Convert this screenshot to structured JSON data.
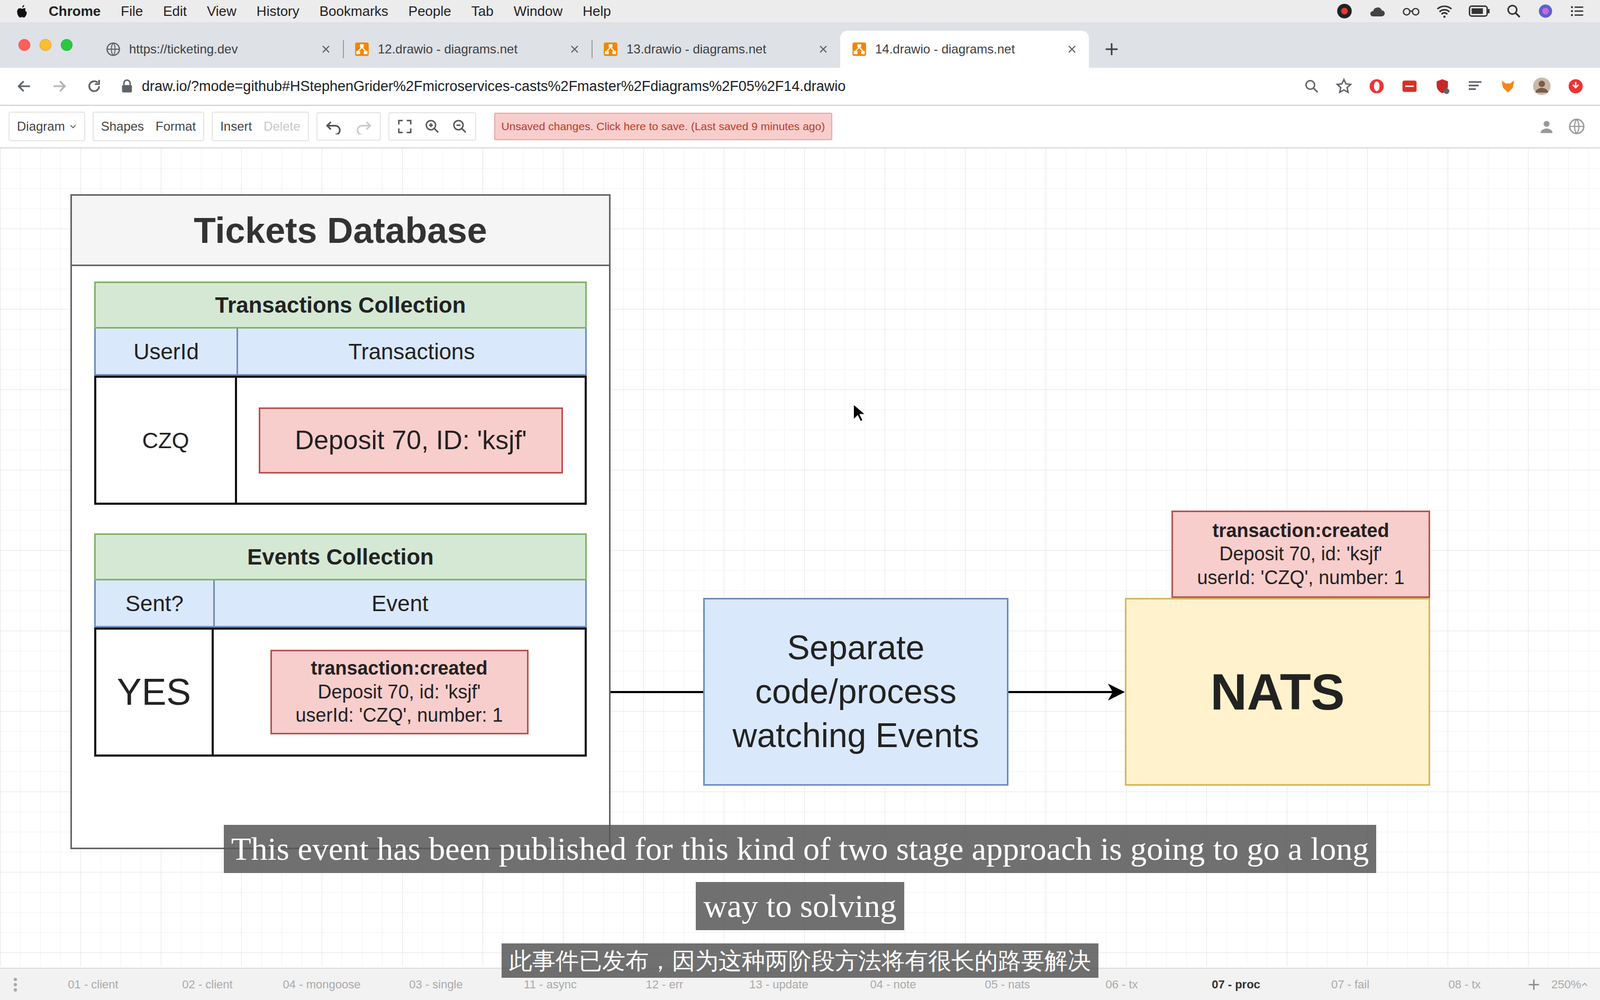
{
  "menubar": {
    "app": "Chrome",
    "items": [
      "File",
      "Edit",
      "View",
      "History",
      "Bookmarks",
      "People",
      "Tab",
      "Window",
      "Help"
    ]
  },
  "tabs": [
    {
      "label": "https://ticketing.dev",
      "kind": "web",
      "selected": false
    },
    {
      "label": "12.drawio - diagrams.net",
      "kind": "drawio",
      "selected": false
    },
    {
      "label": "13.drawio - diagrams.net",
      "kind": "drawio",
      "selected": false
    },
    {
      "label": "14.drawio - diagrams.net",
      "kind": "drawio",
      "selected": true
    }
  ],
  "address": "draw.io/?mode=github#HStephenGrider%2Fmicroservices-casts%2Fmaster%2Fdiagrams%2F05%2F14.drawio",
  "toolbar": {
    "groups": [
      [
        {
          "label": "Diagram",
          "disabled": false
        }
      ],
      [
        {
          "label": "Shapes",
          "disabled": false
        },
        {
          "label": "Format",
          "disabled": false
        }
      ],
      [
        {
          "label": "Insert",
          "disabled": false
        },
        {
          "label": "Delete",
          "disabled": true
        }
      ]
    ],
    "notice": "Unsaved changes. Click here to save. (Last saved 9 minutes ago)"
  },
  "history": {
    "undo_enabled": true,
    "redo_enabled": false
  },
  "diagram": {
    "database": {
      "title": "Tickets Database",
      "collections": [
        {
          "title": "Transactions Collection",
          "kind": "transactions",
          "columns": [
            "UserId",
            "Transactions"
          ],
          "rows": [
            {
              "key": "CZQ",
              "value": [
                "Deposit 70, ID: 'ksjf'"
              ]
            }
          ]
        },
        {
          "title": "Events Collection",
          "kind": "events",
          "columns": [
            "Sent?",
            "Event"
          ],
          "rows": [
            {
              "key": "YES",
              "value": [
                "transaction:created",
                "Deposit 70, id: 'ksjf'",
                "userId: 'CZQ', number: 1"
              ]
            }
          ]
        }
      ]
    },
    "process": [
      "Separate",
      "code/process",
      "watching Events"
    ],
    "nats": "NATS",
    "published": [
      "transaction:created",
      "Deposit 70, id: 'ksjf'",
      "userId: 'CZQ', number: 1"
    ]
  },
  "subtitles": {
    "english": [
      "This event has been published for this kind of two stage approach is going to go a long",
      "way to solving"
    ],
    "chinese": "此事件已发布，因为这种两阶段方法将有很长的路要解决"
  },
  "pages": [
    {
      "label": "01 - client",
      "selected": false
    },
    {
      "label": "02 - client",
      "selected": false
    },
    {
      "label": "04 - mongoose",
      "selected": false
    },
    {
      "label": "03 - single",
      "selected": false
    },
    {
      "label": "11 - async",
      "selected": false
    },
    {
      "label": "12 - err",
      "selected": false
    },
    {
      "label": "13 - update",
      "selected": false
    },
    {
      "label": "04 - note",
      "selected": false
    },
    {
      "label": "05 - nats",
      "selected": false
    },
    {
      "label": "06 - tx",
      "selected": false
    },
    {
      "label": "07 - proc",
      "selected": true
    },
    {
      "label": "07 - fail",
      "selected": false
    },
    {
      "label": "08 - tx",
      "selected": false
    }
  ],
  "zoom": "250%"
}
